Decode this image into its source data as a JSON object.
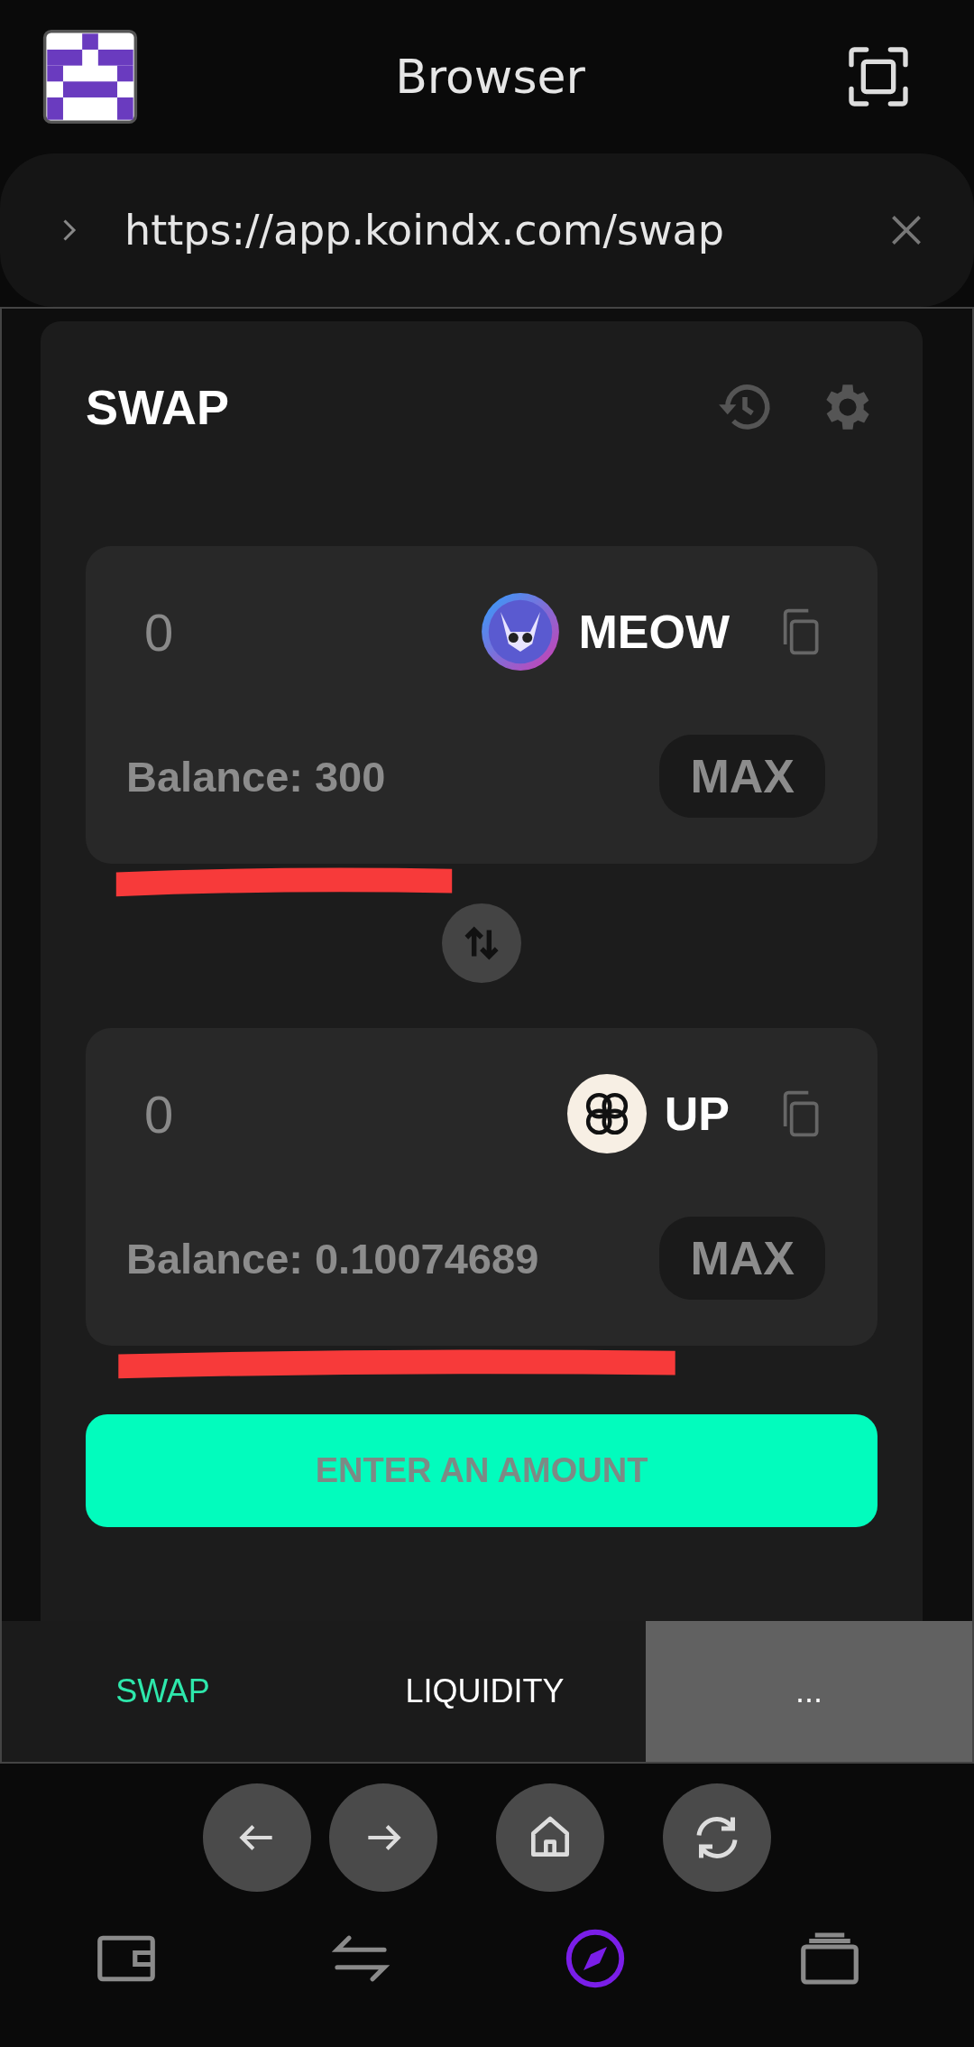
{
  "header": {
    "title": "Browser"
  },
  "address_bar": {
    "url": "https://app.koindx.com/swap"
  },
  "swap": {
    "title": "SWAP",
    "tokens": [
      {
        "amount": "0",
        "symbol": "MEOW",
        "kind": "cat",
        "balance": "Balance: 300",
        "max": "MAX",
        "highlighted": true
      },
      {
        "amount": "0",
        "symbol": "UP",
        "kind": "flower",
        "balance": "Balance: 0.10074689",
        "max": "MAX",
        "highlighted": true
      }
    ],
    "action_button": "ENTER AN AMOUNT"
  },
  "tabs": [
    {
      "label": "SWAP",
      "selected": true
    },
    {
      "label": "LIQUIDITY",
      "selected": false
    },
    {
      "label": "...",
      "selected": false,
      "kind": "more"
    }
  ],
  "bottom_nav": [
    {
      "kind": "wallet",
      "selected": false
    },
    {
      "kind": "transfer",
      "selected": false
    },
    {
      "kind": "browser",
      "selected": true
    },
    {
      "kind": "tabs",
      "selected": false
    }
  ]
}
